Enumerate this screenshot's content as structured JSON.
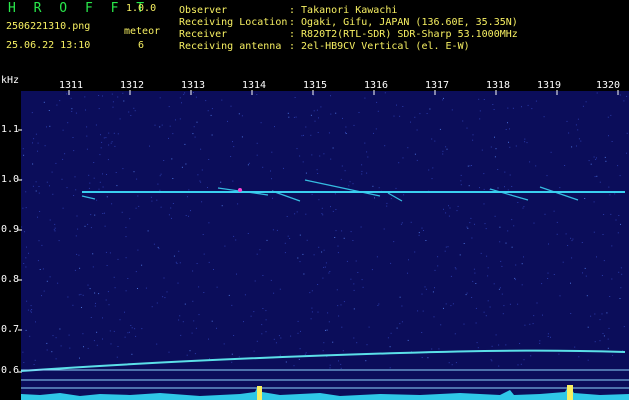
{
  "app": {
    "name": "H R O F F T",
    "version": "1.0.0"
  },
  "file": {
    "name": "2506221310.png",
    "datetime": "25.06.22 13:10"
  },
  "meteor": {
    "label": "meteor",
    "count": "6"
  },
  "info": [
    {
      "key": "Observer",
      "value": ": Takanori Kawachi"
    },
    {
      "key": "Receiving Location",
      "value": ": Ogaki, Gifu, JAPAN (136.60E, 35.35N)"
    },
    {
      "key": "Receiver",
      "value": ": R820T2(RTL-SDR) SDR-Sharp 53.1000MHz"
    },
    {
      "key": "Receiving antenna",
      "value": ": 2el-HB9CV Vertical (el. E-W)"
    }
  ],
  "axis": {
    "y_unit": "kHz",
    "y_ticks": [
      "1.1",
      "1.0",
      "0.9",
      "0.8",
      "0.7",
      "0.6"
    ],
    "x_ticks": [
      "1311",
      "1312",
      "1313",
      "1314",
      "1315",
      "1316",
      "1317",
      "1318",
      "1319",
      "1320"
    ]
  },
  "colors": {
    "yellow": "#f7f062",
    "green": "#29e84b",
    "background": "#0b0d5a",
    "trace": "#3ad0f0"
  }
}
